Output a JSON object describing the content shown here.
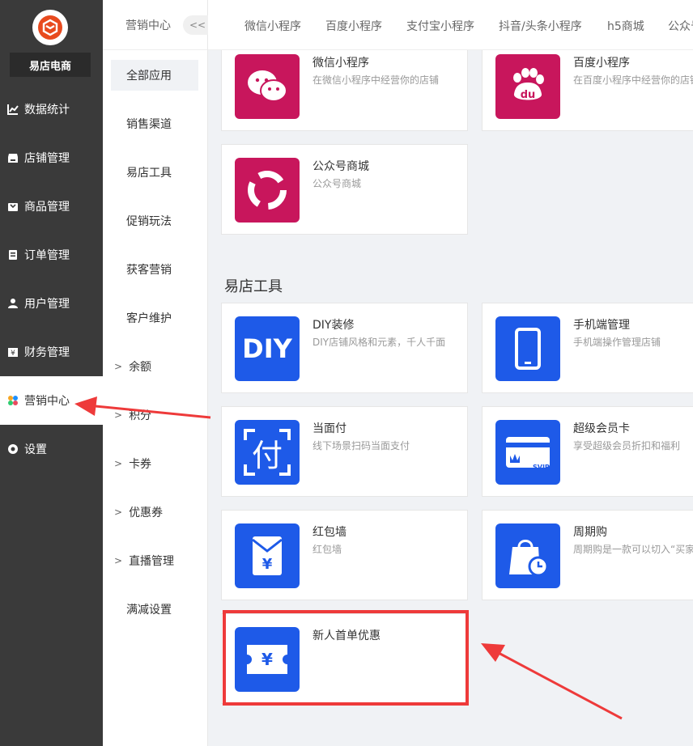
{
  "brand": {
    "name": "易店电商"
  },
  "sidebar": {
    "items": [
      {
        "label": "数据统计",
        "icon": "chart-icon"
      },
      {
        "label": "店铺管理",
        "icon": "store-icon"
      },
      {
        "label": "商品管理",
        "icon": "goods-icon"
      },
      {
        "label": "订单管理",
        "icon": "order-icon"
      },
      {
        "label": "用户管理",
        "icon": "user-icon"
      },
      {
        "label": "财务管理",
        "icon": "finance-icon"
      },
      {
        "label": "营销中心",
        "icon": "marketing-icon",
        "active": true
      },
      {
        "label": "设置",
        "icon": "settings-icon"
      }
    ]
  },
  "subnav": {
    "header": "营销中心",
    "collapse_label": "<<",
    "items": [
      {
        "label": "全部应用"
      },
      {
        "label": "销售渠道"
      },
      {
        "label": "易店工具"
      },
      {
        "label": "促销玩法"
      },
      {
        "label": "获客营销"
      },
      {
        "label": "客户维护"
      },
      {
        "label": "余额"
      },
      {
        "label": "积分"
      },
      {
        "label": "卡券"
      },
      {
        "label": "优惠券"
      },
      {
        "label": "直播管理"
      },
      {
        "label": "满减设置"
      }
    ]
  },
  "tabs": [
    "微信小程序",
    "百度小程序",
    "支付宝小程序",
    "抖音/头条小程序",
    "h5商城",
    "公众号"
  ],
  "channels": [
    {
      "title": "微信小程序",
      "desc": "在微信小程序中经营你的店铺",
      "icon": "wechat-icon",
      "color": "#c8165c"
    },
    {
      "title": "百度小程序",
      "desc": "在百度小程序中经营你的店铺",
      "icon": "baidu-icon",
      "color": "#c8165c"
    },
    {
      "title": "公众号商城",
      "desc": "公众号商城",
      "icon": "official-account-icon",
      "color": "#c8165c"
    }
  ],
  "section_title": "易店工具",
  "tools": [
    {
      "title": "DIY装修",
      "desc": "DIY店铺风格和元素，千人千面",
      "icon": "diy-icon",
      "icon_text": "DIY",
      "color": "#1e5ae8"
    },
    {
      "title": "手机端管理",
      "desc": "手机端操作管理店铺",
      "icon": "phone-icon",
      "color": "#1e5ae8"
    },
    {
      "title": "当面付",
      "desc": "线下场景扫码当面支付",
      "icon": "pay-icon",
      "icon_text": "付",
      "color": "#1e5ae8"
    },
    {
      "title": "超级会员卡",
      "desc": "享受超级会员折扣和福利",
      "icon": "svip-card-icon",
      "icon_text": "SVIP",
      "color": "#1e5ae8"
    },
    {
      "title": "红包墙",
      "desc": "红包墙",
      "icon": "red-envelope-icon",
      "icon_text": "¥",
      "color": "#1e5ae8"
    },
    {
      "title": "周期购",
      "desc": "周期购是一款可以切入“买家",
      "icon": "periodic-purchase-icon",
      "color": "#1e5ae8"
    },
    {
      "title": "新人首单优惠",
      "desc": "",
      "icon": "newcomer-coupon-icon",
      "icon_text": "¥",
      "color": "#1e5ae8"
    }
  ],
  "colors": {
    "sidebar_bg": "#3a3a3a",
    "accent_red": "#ee3a3a",
    "tool_blue": "#1e5ae8",
    "channel_red": "#c8165c"
  }
}
